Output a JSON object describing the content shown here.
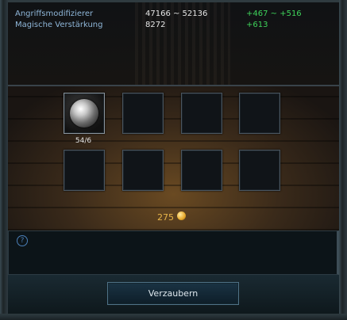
{
  "stats": {
    "rows": [
      {
        "name": "Angriffsmodifizierer",
        "value": "47166 ~ 52136",
        "bonus": "+467 ~ +516"
      },
      {
        "name": "Magische Verstärkung",
        "value": "8272",
        "bonus": "+613"
      }
    ]
  },
  "slots": {
    "first_count": "54/6"
  },
  "cost": {
    "amount": "275",
    "icon": "gold-coin-icon"
  },
  "help": {
    "icon": "help-icon",
    "glyph": "?"
  },
  "actions": {
    "enchant_label": "Verzaubern"
  }
}
